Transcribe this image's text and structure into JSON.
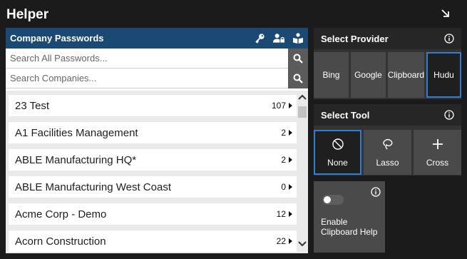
{
  "app": {
    "title": "Helper"
  },
  "passwords": {
    "title": "Company Passwords",
    "search_passwords_placeholder": "Search All Passwords...",
    "search_companies_placeholder": "Search Companies...",
    "companies": [
      {
        "name": "23 Test",
        "count": "107"
      },
      {
        "name": "A1 Facilities Management",
        "count": "2"
      },
      {
        "name": "ABLE Manufacturing HQ*",
        "count": "2"
      },
      {
        "name": "ABLE Manufacturing West Coast",
        "count": "0"
      },
      {
        "name": "Acme Corp - Demo",
        "count": "12"
      },
      {
        "name": "Acorn Construction",
        "count": "22"
      }
    ]
  },
  "provider": {
    "title": "Select Provider",
    "options": [
      {
        "label": "Bing",
        "selected": false
      },
      {
        "label": "Google",
        "selected": false
      },
      {
        "label": "Clipboard",
        "selected": false
      },
      {
        "label": "Hudu",
        "selected": true
      }
    ]
  },
  "tool": {
    "title": "Select Tool",
    "options": [
      {
        "label": "None",
        "icon": "prohibited-icon",
        "selected": true
      },
      {
        "label": "Lasso",
        "icon": "lasso-icon",
        "selected": false
      },
      {
        "label": "Cross",
        "icon": "plus-icon",
        "selected": false
      }
    ]
  },
  "clipboard_help": {
    "label": "Enable Clipboard Help",
    "enabled": false
  },
  "colors": {
    "header_blue": "#1a4a73",
    "selected_border": "#2d7fd2",
    "background": "#1b1b1b"
  }
}
